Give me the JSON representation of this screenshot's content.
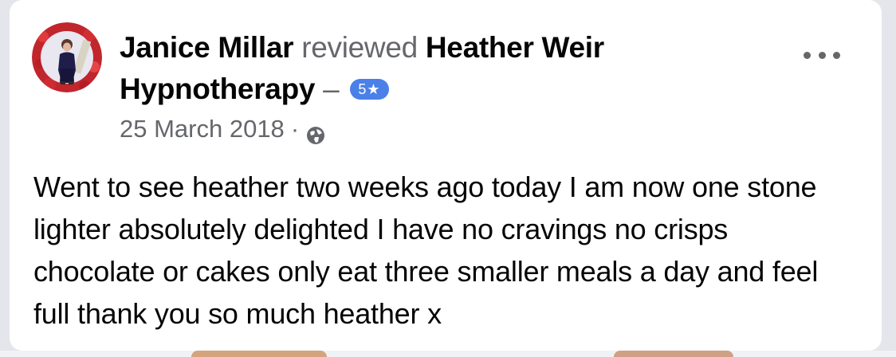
{
  "review": {
    "author": "Janice Millar",
    "verb": "reviewed",
    "page_name": "Heather Weir Hypnotherapy",
    "dash": "–",
    "rating_badge": "5★",
    "date": "25 March 2018",
    "separator": "·",
    "privacy_icon": "globe-icon",
    "more_icon": "more-options-icon",
    "text": "Went to see heather two weeks ago today I am now one stone lighter absolutely delighted I have no cravings no crisps chocolate or cakes only eat three smaller meals a day and feel full thank you so much heather x"
  },
  "colors": {
    "card_background": "#ffffff",
    "primary_text": "#050505",
    "secondary_text": "#65676b",
    "rating_badge": "#4a80e8",
    "page_background": "#e4e6eb"
  }
}
